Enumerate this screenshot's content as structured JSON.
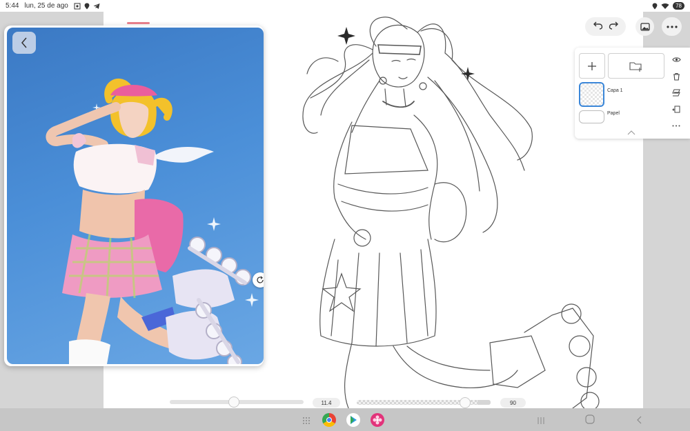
{
  "status": {
    "time": "5:44",
    "date": "lun, 25 de ago",
    "battery": "78"
  },
  "layers": {
    "items": [
      {
        "name": "Capa 1",
        "selected": true
      },
      {
        "name": "Papel",
        "selected": false
      }
    ]
  },
  "brush": {
    "size_value": "11.4",
    "size_fraction": 0.48,
    "opacity_value": "90",
    "opacity_fraction": 0.9
  },
  "icons": {
    "back": "chevron-left-icon",
    "undo": "undo-icon",
    "redo": "redo-icon",
    "gallery": "image-icon",
    "more": "more-icon",
    "add": "plus-icon",
    "folder": "folder-plus-icon",
    "visibility": "eye-icon",
    "delete": "trash-icon",
    "merge": "layers-icon",
    "move": "move-icon"
  },
  "colors": {
    "accent": "#3a86d8",
    "handle": "#e57e8a"
  }
}
